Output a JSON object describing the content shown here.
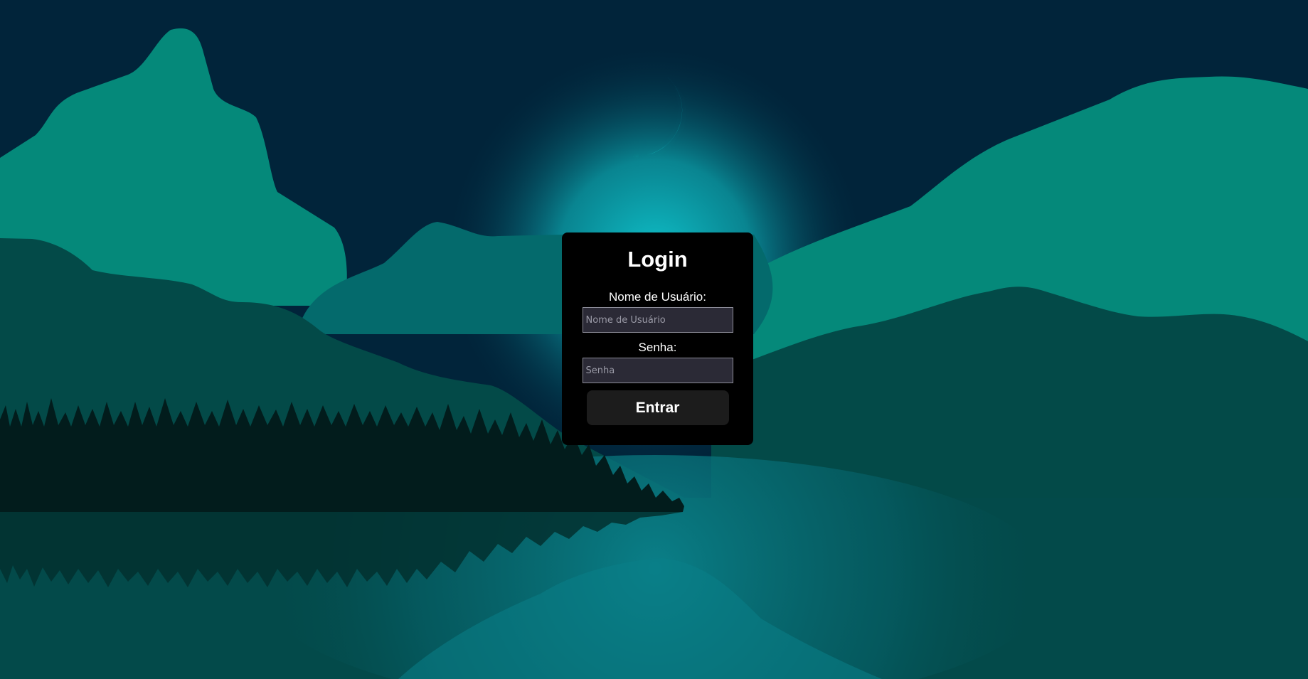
{
  "login": {
    "title": "Login",
    "username_label": "Nome de Usuário:",
    "username_placeholder": "Nome de Usuário",
    "username_value": "",
    "password_label": "Senha:",
    "password_placeholder": "Senha",
    "password_value": "",
    "submit_label": "Entrar"
  },
  "colors": {
    "sky": "#01243a",
    "mountain_light": "#05897a",
    "mountain_mid": "#045e5f",
    "mountain_dark": "#034a48",
    "moon": "#19e6e6",
    "card": "#000000",
    "button": "#1c1c1c"
  },
  "icons": {
    "moon": "crescent-moon-icon"
  }
}
